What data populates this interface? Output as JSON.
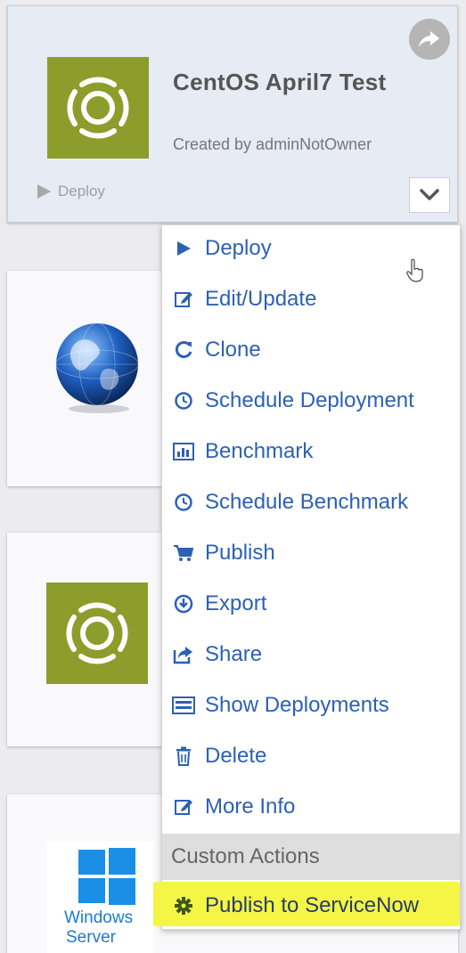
{
  "card1": {
    "title": "CentOS April7 Test",
    "owner": "Created by adminNotOwner",
    "deploy_label": "Deploy"
  },
  "windows_logo": {
    "line1": "Windows",
    "line2": "Server"
  },
  "menu": {
    "items": [
      {
        "label": "Deploy",
        "icon": "play-icon"
      },
      {
        "label": "Edit/Update",
        "icon": "edit-icon"
      },
      {
        "label": "Clone",
        "icon": "refresh-icon"
      },
      {
        "label": "Schedule Deployment",
        "icon": "clock-icon"
      },
      {
        "label": "Benchmark",
        "icon": "bar-chart-icon"
      },
      {
        "label": "Schedule Benchmark",
        "icon": "clock-icon"
      },
      {
        "label": "Publish",
        "icon": "cart-icon"
      },
      {
        "label": "Export",
        "icon": "download-icon"
      },
      {
        "label": "Share",
        "icon": "share-icon"
      },
      {
        "label": "Show Deployments",
        "icon": "list-icon"
      },
      {
        "label": "Delete",
        "icon": "trash-icon"
      },
      {
        "label": "More Info",
        "icon": "edit-icon"
      }
    ],
    "custom_header": "Custom Actions",
    "custom_item": {
      "label": "Publish to ServiceNow",
      "icon": "gear-icon"
    }
  },
  "colors": {
    "link": "#2c61b5",
    "centos_green": "#8d9d2c",
    "highlight": "#f5f545"
  }
}
